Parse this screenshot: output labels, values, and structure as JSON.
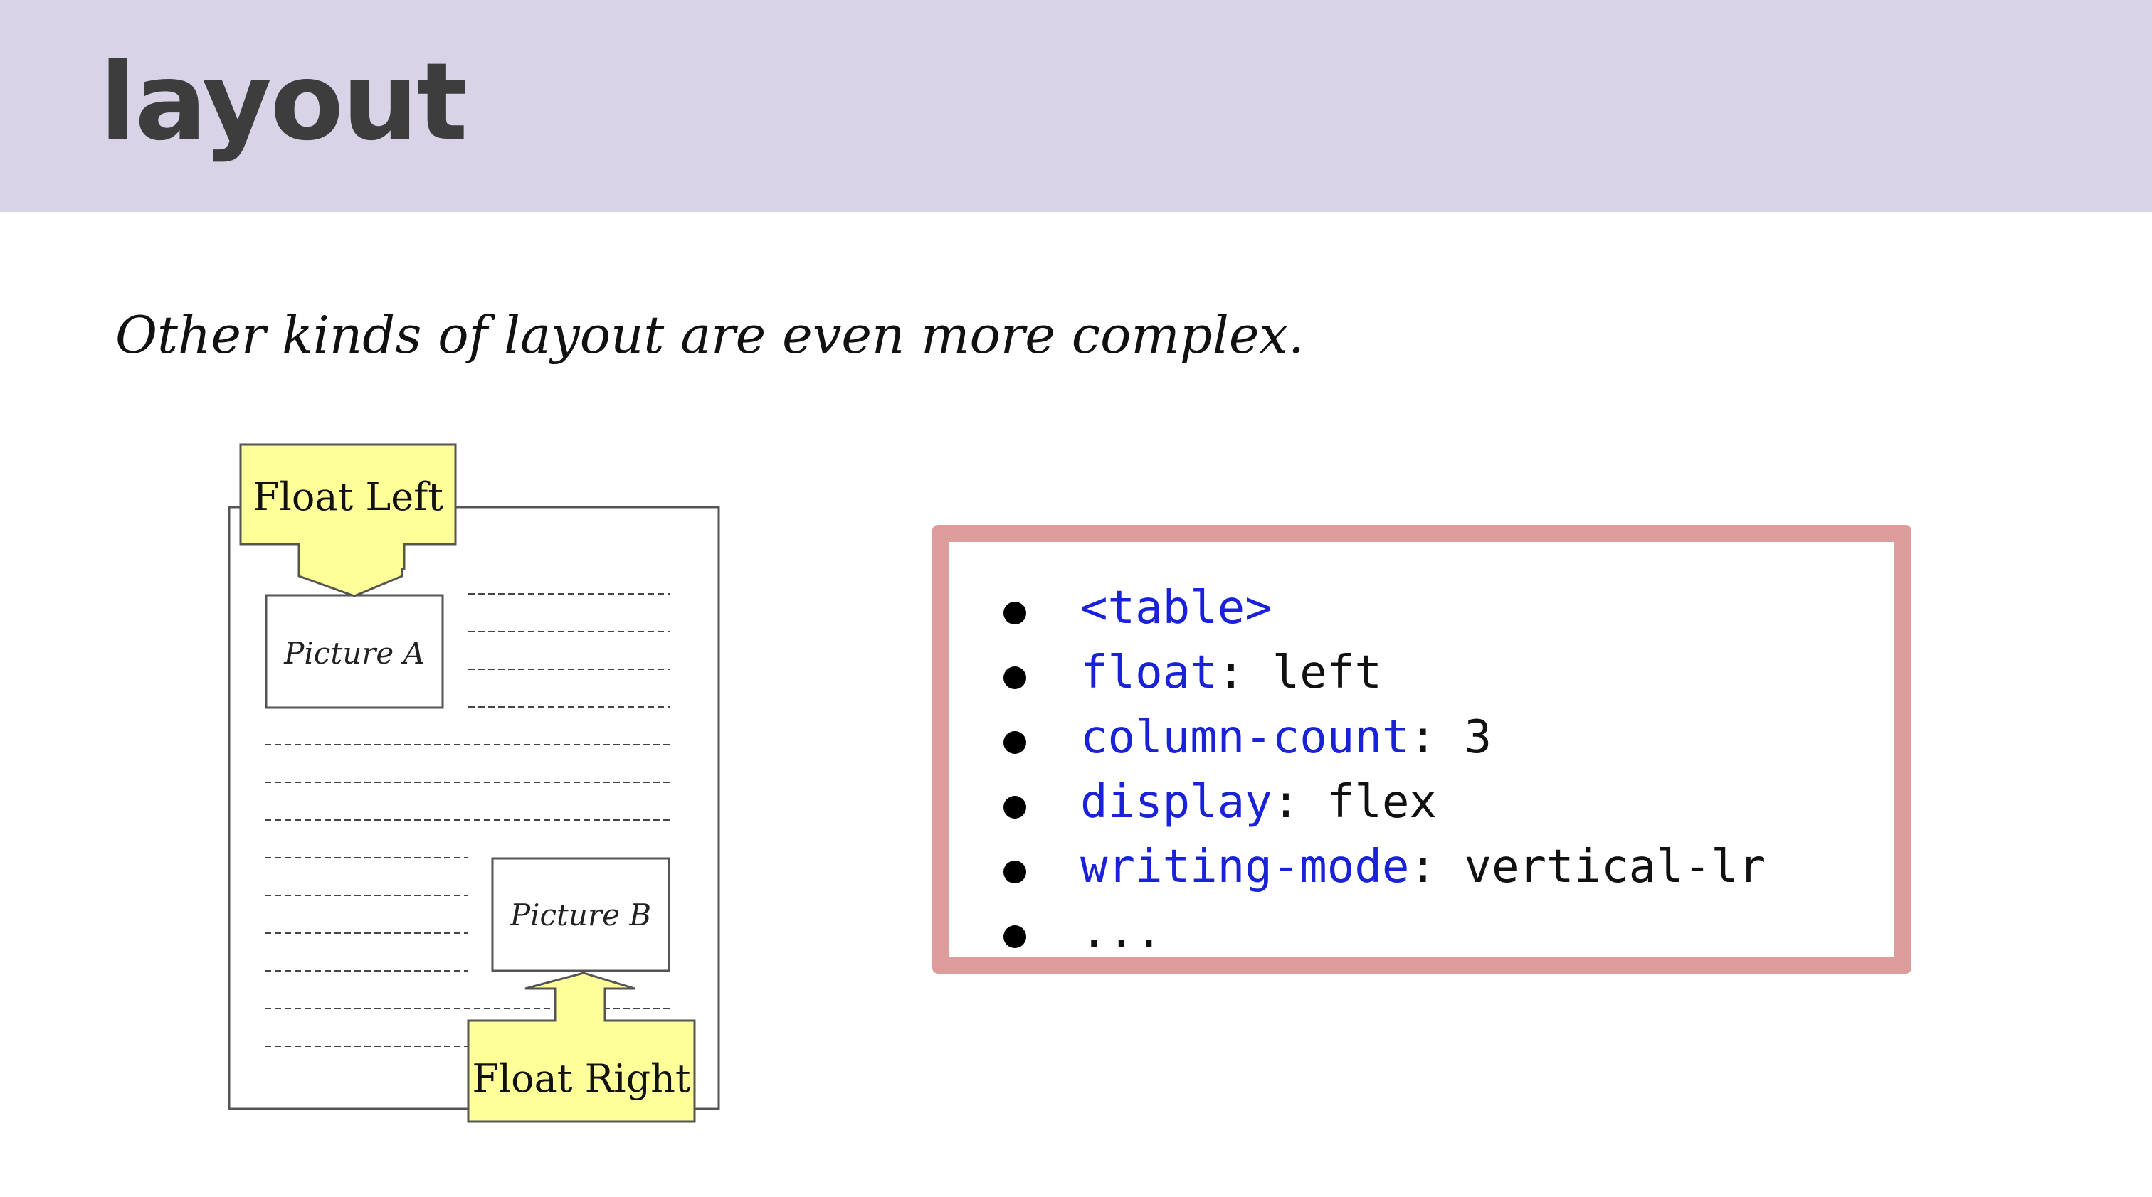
{
  "slide": {
    "title": "layout",
    "subtitle": "Other kinds of layout are even more complex."
  },
  "figure": {
    "labels": {
      "float_left": "Float Left",
      "float_right": "Float Right",
      "picture_a": "Picture A",
      "picture_b": "Picture B"
    }
  },
  "code_list": {
    "items": [
      {
        "keyword": "<table>",
        "rest": ""
      },
      {
        "keyword": "float",
        "rest": ": left"
      },
      {
        "keyword": "column-count",
        "rest": ": 3"
      },
      {
        "keyword": "display",
        "rest": ": flex"
      },
      {
        "keyword": "writing-mode",
        "rest": ": vertical-lr"
      },
      {
        "keyword": "",
        "rest": "..."
      }
    ]
  },
  "colors": {
    "header_bg": "#d9d3e8",
    "box_border": "#dc9c9c",
    "keyword": "#1a22d8",
    "callout_fill": "#ffff99"
  }
}
